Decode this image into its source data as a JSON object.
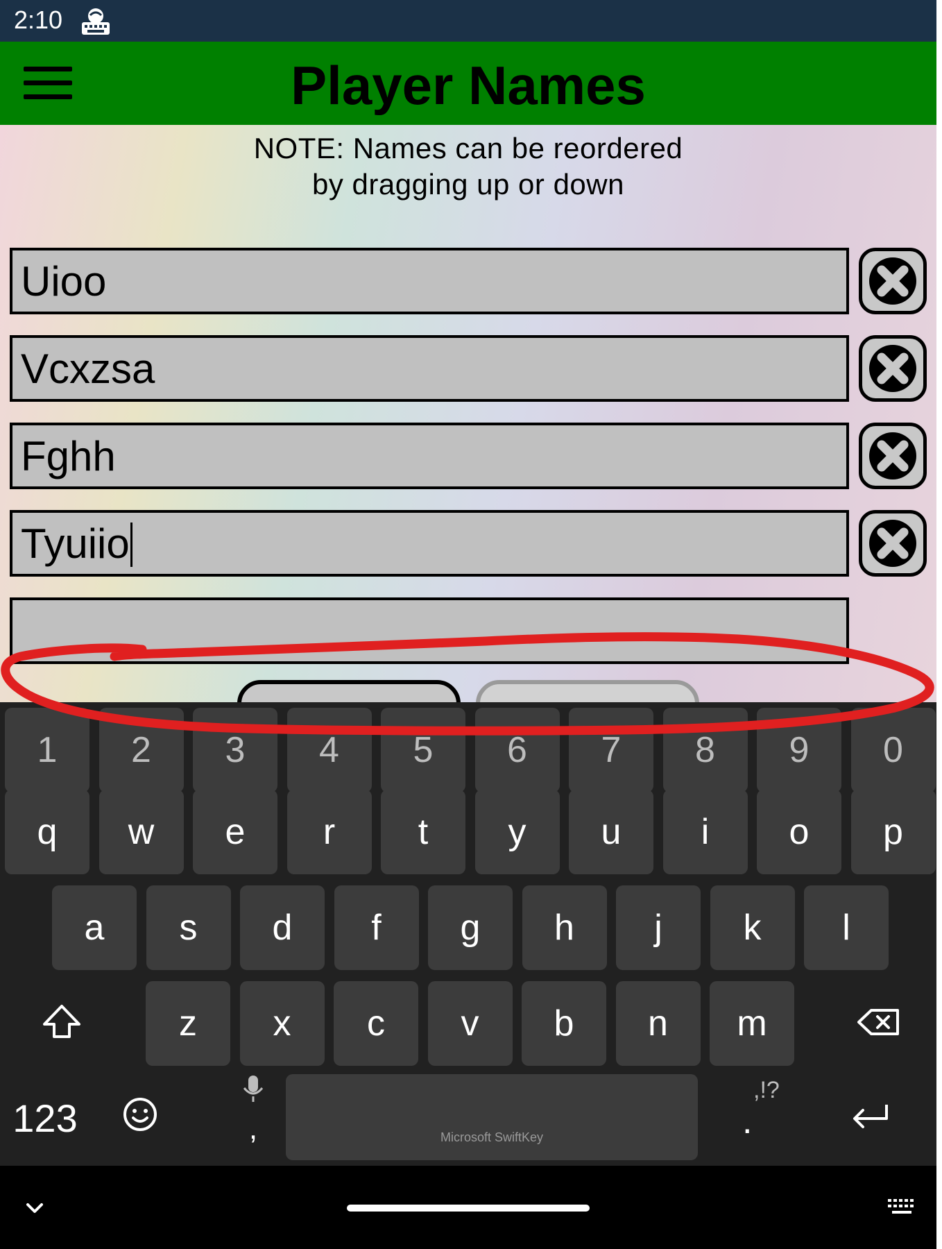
{
  "status_bar": {
    "time": "2:10",
    "notification_icon": "keyboard-app-icon"
  },
  "app_bar": {
    "title": "Player Names",
    "menu_icon": "hamburger-menu-icon",
    "background": "#008000"
  },
  "note": {
    "line1": "NOTE: Names can be reordered",
    "line2": "by dragging up or down"
  },
  "players": [
    {
      "name": "Uioo"
    },
    {
      "name": "Vcxzsa"
    },
    {
      "name": "Fghh"
    },
    {
      "name": "Tyuiio"
    }
  ],
  "new_player": {
    "value": ""
  },
  "buttons": {
    "delete_icon": "close-x-icon"
  },
  "annotation": {
    "color": "#e02020",
    "shape": "hand-drawn ellipse"
  },
  "keyboard": {
    "brand": "Microsoft SwiftKey",
    "number_row": [
      "1",
      "2",
      "3",
      "4",
      "5",
      "6",
      "7",
      "8",
      "9",
      "0"
    ],
    "row1": [
      "q",
      "w",
      "e",
      "r",
      "t",
      "y",
      "u",
      "i",
      "o",
      "p"
    ],
    "row2": [
      "a",
      "s",
      "d",
      "f",
      "g",
      "h",
      "j",
      "k",
      "l"
    ],
    "row3": [
      "z",
      "x",
      "c",
      "v",
      "b",
      "n",
      "m"
    ],
    "numbers_key": "123",
    "comma_key": ",",
    "period_key": ".",
    "punct_hint": ",!?",
    "icons": {
      "shift": "shift-arrow-icon",
      "backspace": "backspace-icon",
      "emoji": "emoji-smiley-icon",
      "mic": "microphone-icon",
      "enter": "enter-return-icon"
    }
  },
  "nav_bar": {
    "collapse_icon": "chevron-down-icon",
    "keyboard_switch_icon": "keyboard-grid-icon"
  }
}
